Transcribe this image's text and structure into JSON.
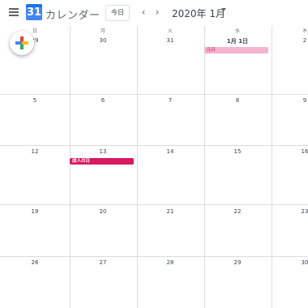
{
  "header": {
    "app_name": "カレンダー",
    "logo_day": "31",
    "today_label": "今日",
    "prev_label": "‹",
    "next_label": "›",
    "month_title": "2020年 1月"
  },
  "weekdays": [
    "日",
    "月",
    "火",
    "水",
    "木"
  ],
  "weeks": [
    [
      "29",
      "30",
      "31",
      "1月 1日",
      "2"
    ],
    [
      "5",
      "6",
      "7",
      "8",
      "9"
    ],
    [
      "12",
      "13",
      "14",
      "15",
      "16"
    ],
    [
      "19",
      "20",
      "21",
      "22",
      "23"
    ],
    [
      "26",
      "27",
      "28",
      "29",
      "30"
    ]
  ],
  "events": [
    {
      "title": "元日",
      "date": "1月 1日",
      "color": "#f4b5cc"
    },
    {
      "title": "成人の日",
      "date": "13",
      "color": "#d81b60"
    }
  ],
  "fab": {
    "icon": "plus-icon"
  }
}
